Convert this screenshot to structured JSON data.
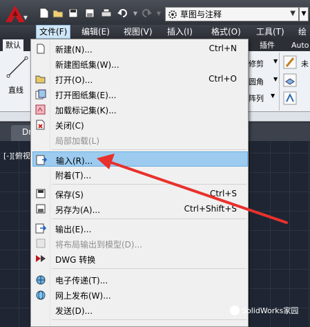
{
  "window": {
    "workspace": "草图与注释"
  },
  "menubar": {
    "items": [
      {
        "label": "文件(F)",
        "active": true
      },
      {
        "label": "编辑(E)"
      },
      {
        "label": "视图(V)"
      },
      {
        "label": "插入(I)"
      },
      {
        "label": "格式(O)"
      },
      {
        "label": "工具(T)"
      },
      {
        "label": "绘"
      }
    ]
  },
  "ribbon": {
    "tabs": [
      "默认",
      "插件",
      "Auto"
    ],
    "line_tool": "直线",
    "modify": [
      "修剪",
      "圆角",
      "阵列"
    ],
    "side_label": "未"
  },
  "doc_tab": "Dr",
  "viewport_label": "[-][俯视",
  "file_menu": {
    "items": [
      {
        "label": "新建(N)...",
        "shortcut": "Ctrl+N",
        "icon": "new-file-icon"
      },
      {
        "label": "新建图纸集(W)...",
        "icon": ""
      },
      {
        "label": "打开(O)...",
        "shortcut": "Ctrl+O",
        "icon": "open-folder-icon"
      },
      {
        "label": "打开图纸集(E)...",
        "icon": "open-sheetset-icon"
      },
      {
        "label": "加载标记集(K)...",
        "icon": "markup-icon"
      },
      {
        "label": "关闭(C)",
        "icon": "close-file-icon"
      },
      {
        "label": "局部加载(L)",
        "disabled": true
      },
      {
        "label": "输入(R)...",
        "highlighted": true,
        "icon": "import-icon"
      },
      {
        "label": "附着(T)...",
        "icon": ""
      },
      {
        "label": "保存(S)",
        "shortcut": "Ctrl+S",
        "icon": "save-icon"
      },
      {
        "label": "另存为(A)...",
        "shortcut": "Ctrl+Shift+S",
        "icon": "save-as-icon"
      },
      {
        "label": "输出(E)...",
        "icon": "export-icon"
      },
      {
        "label": "将布局输出到模型(D)...",
        "disabled": true,
        "icon": "layout-export-icon"
      },
      {
        "label": "DWG 转换",
        "icon": "dwg-convert-icon"
      },
      {
        "label": "电子传递(T)...",
        "icon": "etransmit-icon"
      },
      {
        "label": "网上发布(W)...",
        "icon": "publish-web-icon"
      },
      {
        "label": "发送(D)...",
        "icon": ""
      }
    ]
  },
  "annotation": {
    "arrow_color": "#e8312c"
  },
  "watermark": "SolidWorks家园"
}
